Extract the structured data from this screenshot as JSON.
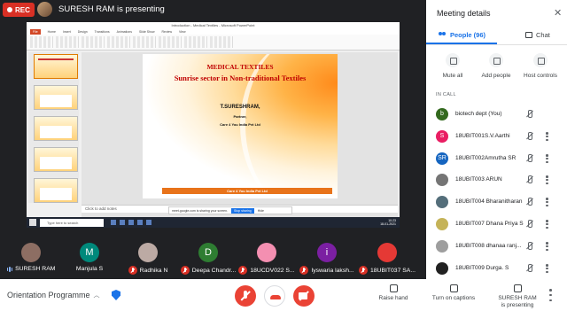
{
  "recording_badge": "REC",
  "presenter_banner": "SURESH RAM is presenting",
  "shared_screen": {
    "window_title": "Introduction - Medical Textiles - Microsoft PowerPoint",
    "ribbon_tabs": [
      "File",
      "Home",
      "Insert",
      "Design",
      "Transitions",
      "Animations",
      "Slide Show",
      "Review",
      "View"
    ],
    "slide": {
      "title": "MEDICAL TEXTILES",
      "subtitle": "Sunrise sector in Non-traditional Textiles",
      "author": "T.SURESHRAM,",
      "role": "Partner,",
      "company": "Care 4 You India Pvt Ltd",
      "footer": "Care 4 You India Pvt Ltd"
    },
    "notes_placeholder": "Click to add notes",
    "share_notice": "meet.google.com is sharing your screen.",
    "share_stop": "Stop sharing",
    "share_hide": "Hide",
    "taskbar_search": "Type here to search",
    "clock_time": "10:23",
    "clock_date": "18-01-2021"
  },
  "participants_strip": [
    {
      "name": "SURESH RAM",
      "initial": "",
      "color": "#8d6e63",
      "state": "speaking"
    },
    {
      "name": "Manjula S",
      "initial": "M",
      "color": "#00897b",
      "state": "none"
    },
    {
      "name": "Radhika N",
      "initial": "",
      "color": "#bcaaa4",
      "state": "muted"
    },
    {
      "name": "Deepa Chandr...",
      "initial": "D",
      "color": "#2e7d32",
      "state": "muted"
    },
    {
      "name": "18UCDV022 S...",
      "initial": "",
      "color": "#f48fb1",
      "state": "muted"
    },
    {
      "name": "Iyswaria laksh...",
      "initial": "i",
      "color": "#7b1fa2",
      "state": "muted"
    },
    {
      "name": "18UBIT037 SA...",
      "initial": "",
      "color": "#e53935",
      "state": "muted"
    }
  ],
  "controls": {
    "meeting_title": "Orientation Programme",
    "raise_hand": "Raise hand",
    "captions": "Turn on captions",
    "presenting_line1": "SURESH RAM",
    "presenting_line2": "is presenting"
  },
  "panel": {
    "title": "Meeting details",
    "close": "✕",
    "tab_people": "People (96)",
    "tab_chat": "Chat",
    "actions": [
      "Mute all",
      "Add people",
      "Host controls"
    ],
    "in_call_label": "IN CALL",
    "people": [
      {
        "name": "biotech dept (You)",
        "initial": "b",
        "color": "#33691e",
        "kebab": false
      },
      {
        "name": "18UBIT001S.V.Aarthi",
        "initial": "S",
        "color": "#e91e63",
        "kebab": true
      },
      {
        "name": "18UBIT002Amrutha SR",
        "initial": "SR",
        "color": "#1565c0",
        "kebab": true
      },
      {
        "name": "18UBIT003 ARUN",
        "initial": "",
        "color": "#757575",
        "kebab": true
      },
      {
        "name": "18UBIT004 Bharanitharan",
        "initial": "",
        "color": "#546e7a",
        "kebab": true
      },
      {
        "name": "18UBIT007 Dhana Priya S",
        "initial": "",
        "color": "#c5b358",
        "kebab": true
      },
      {
        "name": "18UBIT008 dhanaa ranj...",
        "initial": "",
        "color": "#9e9e9e",
        "kebab": true
      },
      {
        "name": "18UBIT009 Durga. S",
        "initial": "",
        "color": "#212121",
        "kebab": true
      }
    ]
  }
}
